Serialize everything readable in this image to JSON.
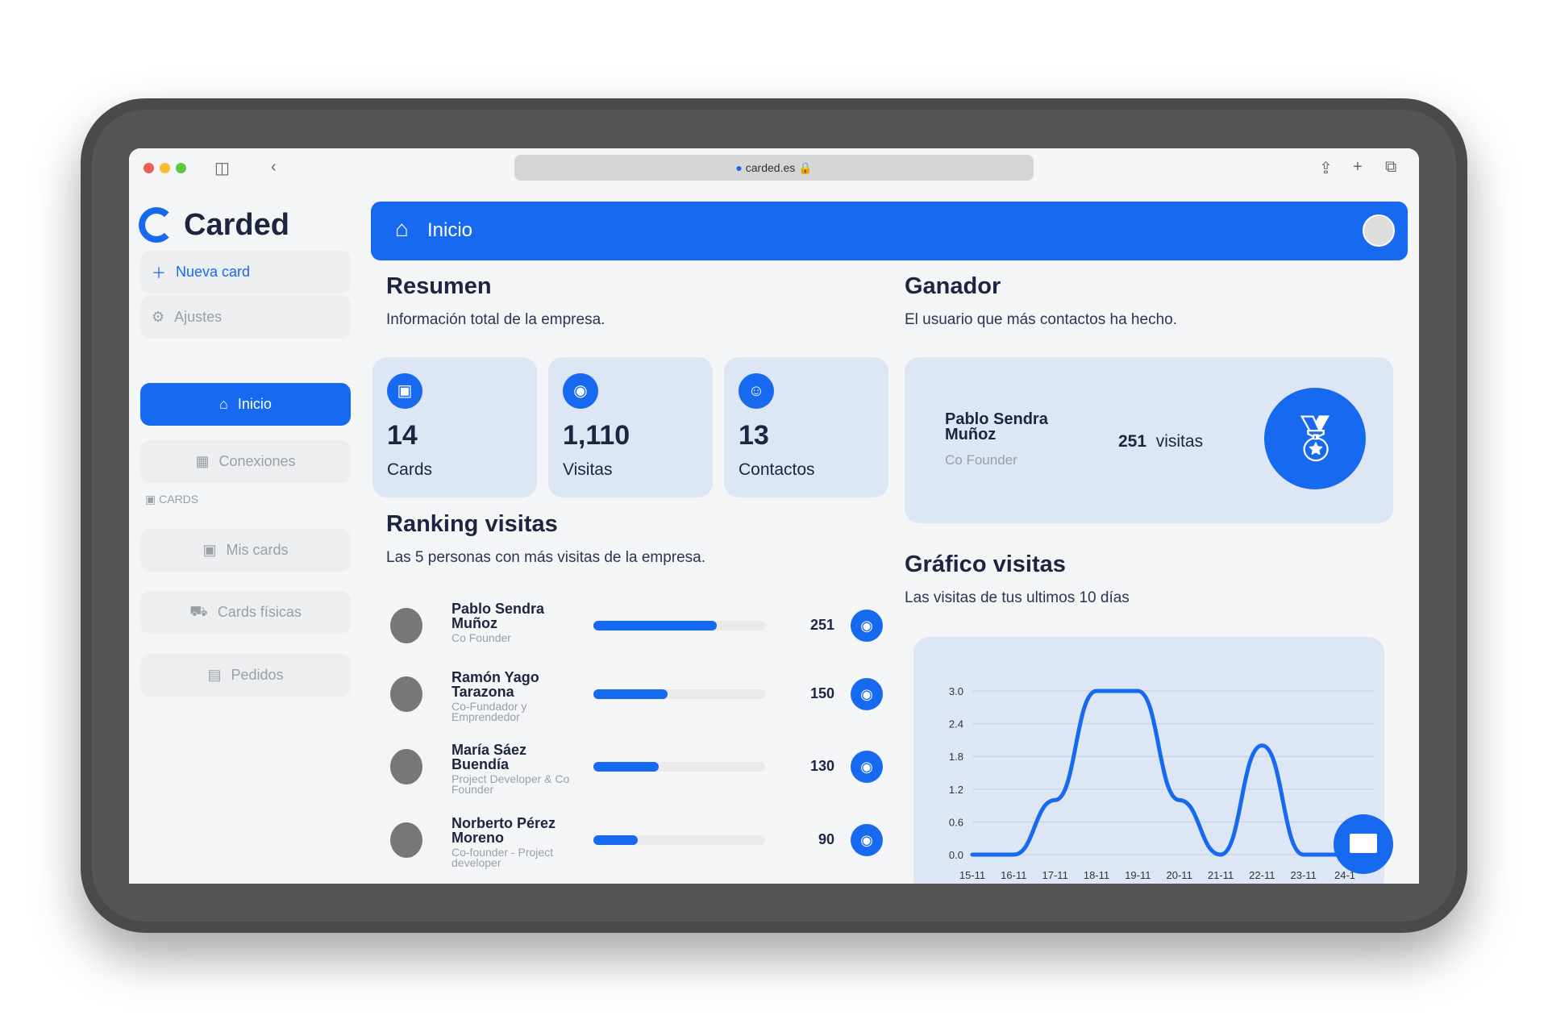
{
  "browser": {
    "url": "carded.es"
  },
  "header": {
    "title": "Inicio"
  },
  "sidebar": {
    "brand": "Carded",
    "new_card": "Nueva card",
    "settings": "Ajustes",
    "section_label": "CARDS",
    "items": [
      {
        "label": "Inicio"
      },
      {
        "label": "Conexiones"
      },
      {
        "label": "Mis cards"
      },
      {
        "label": "Cards físicas"
      },
      {
        "label": "Pedidos"
      }
    ]
  },
  "summary": {
    "title": "Resumen",
    "subtitle": "Información total de la empresa.",
    "stats": [
      {
        "value": "14",
        "label": "Cards",
        "icon": "id-card-icon"
      },
      {
        "value": "1,110",
        "label": "Visitas",
        "icon": "eye-icon"
      },
      {
        "value": "13",
        "label": "Contactos",
        "icon": "user-icon"
      }
    ]
  },
  "winner": {
    "title": "Ganador",
    "subtitle": "El usuario que más contactos ha hecho.",
    "name": "Pablo Sendra Muñoz",
    "role": "Co Founder",
    "visits": "251",
    "visits_label": "visitas"
  },
  "ranking": {
    "title": "Ranking visitas",
    "subtitle": "Las 5 personas con más visitas de la empresa.",
    "rows": [
      {
        "name": "Pablo Sendra Muñoz",
        "role": "Co Founder",
        "visits": "251",
        "fraction": 0.72
      },
      {
        "name": "Ramón Yago Tarazona",
        "role": "Co-Fundador y Emprendedor",
        "visits": "150",
        "fraction": 0.43
      },
      {
        "name": "María Sáez Buendía",
        "role": "Project Developer & Co Founder",
        "visits": "130",
        "fraction": 0.38
      },
      {
        "name": "Norberto Pérez Moreno",
        "role": "Co-founder - Project developer",
        "visits": "90",
        "fraction": 0.26
      }
    ]
  },
  "visits_chart": {
    "title": "Gráfico visitas",
    "subtitle": "Las visitas de tus ultimos 10 días"
  },
  "chart_data": {
    "type": "line",
    "categories": [
      "15-11",
      "16-11",
      "17-11",
      "18-11",
      "19-11",
      "20-11",
      "21-11",
      "22-11",
      "23-11",
      "24-1"
    ],
    "values": [
      0,
      0,
      1,
      3,
      3,
      1,
      0,
      2,
      0,
      0
    ],
    "yticks": [
      "0.0",
      "0.6",
      "1.2",
      "1.8",
      "2.4",
      "3.0"
    ],
    "ylim": [
      0,
      3
    ],
    "color": "#1769f0"
  }
}
